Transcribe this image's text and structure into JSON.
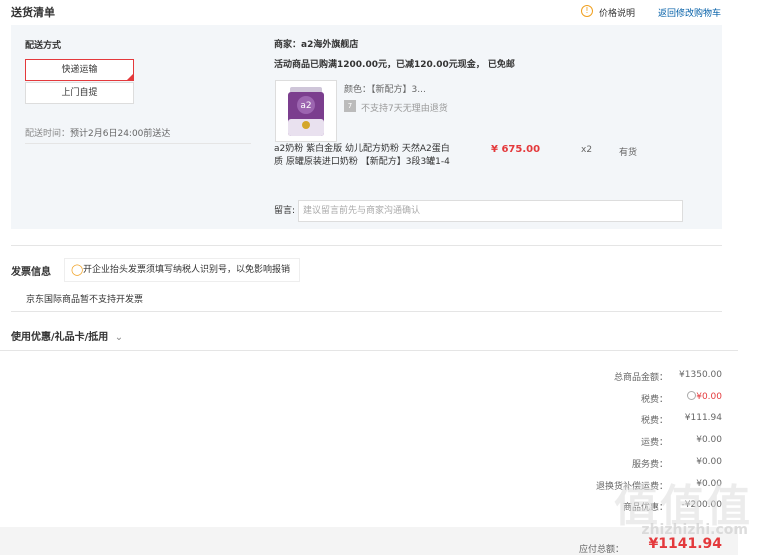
{
  "header": {
    "title": "送货清单",
    "price_info": "价格说明",
    "back_cart": "返回修改购物车"
  },
  "delivery": {
    "label": "配送方式",
    "options": [
      "快递运输",
      "上门自提"
    ],
    "time_label": "配送时间：",
    "time_value": "预计2月6日24:00前送达"
  },
  "merchant": {
    "label": "商家：",
    "name": "a2海外旗舰店",
    "promo": "活动商品已购满1200.00元，已减120.00元现金， 已免邮"
  },
  "product": {
    "color_label": "颜色：",
    "color_value": "【新配方】3...",
    "return_note": "不支持7天无理由退货",
    "name_line1": "a2奶粉 紫白金版 幼儿配方奶粉 天然A2蛋白",
    "name_line2": "质 原罐原装进口奶粉 【新配方】3段3罐1-4",
    "price": "¥ 675.00",
    "qty": "x2",
    "stock": "有货",
    "can_logo": "a2"
  },
  "note": {
    "label": "留言:",
    "placeholder": "建议留言前先与商家沟通确认"
  },
  "invoice": {
    "title": "发票信息",
    "tip": "开企业抬头发票须填写纳税人识别号，以免影响报销",
    "notice": "京东国际商品暂不支持开发票"
  },
  "coupon": {
    "title": "使用优惠/礼品卡/抵用"
  },
  "summary": {
    "rows": [
      {
        "label": "总商品金额：",
        "value": "¥1350.00"
      },
      {
        "label": "税费：",
        "value": "¥0.00"
      },
      {
        "label": "税费：",
        "value": "¥111.94"
      },
      {
        "label": "运费：",
        "value": "¥0.00"
      },
      {
        "label": "服务费：",
        "value": "¥0.00"
      },
      {
        "label": "退换货补偿运费：",
        "value": "¥0.00"
      },
      {
        "label": "商品优惠：",
        "value": "-¥200.00"
      }
    ],
    "total_label": "应付总额：",
    "total_value": "¥1141.94"
  },
  "watermark": {
    "main": "值值值",
    "site": "zhizhizhi.com"
  },
  "colors": {
    "accent_red": "#e4393c",
    "link_blue": "#005ea7",
    "tip_orange": "#f0a020"
  }
}
